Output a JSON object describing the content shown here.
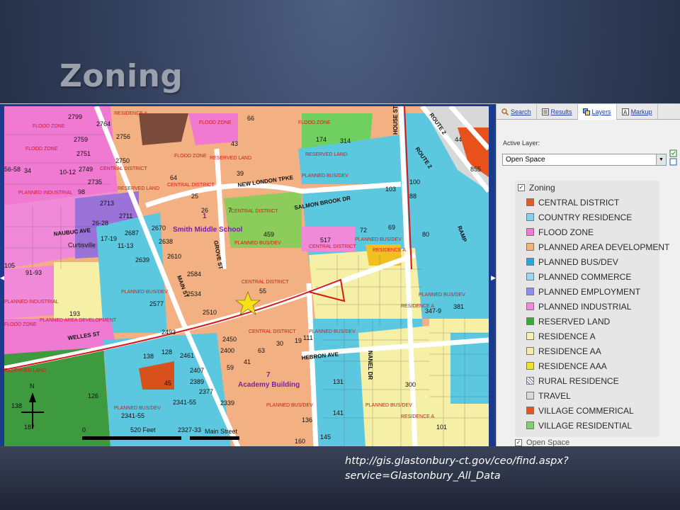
{
  "slide": {
    "title": "Zoning",
    "source_url": "http://gis.glastonbury-ct.gov/ceo/find.aspx?service=Glastonbury_All_Data"
  },
  "tabs": [
    {
      "label": "Search",
      "icon": "search-icon"
    },
    {
      "label": "Results",
      "icon": "results-icon"
    },
    {
      "label": "Layers",
      "icon": "layers-icon"
    },
    {
      "label": "Markup",
      "icon": "markup-icon"
    }
  ],
  "active_layer": {
    "label": "Active Layer:",
    "value": "Open Space"
  },
  "legend": {
    "group": "Zoning",
    "group_checked": true,
    "items": [
      {
        "label": "CENTRAL DISTRICT",
        "color": "#e05a2b"
      },
      {
        "label": "COUNTRY RESIDENCE",
        "color": "#7fd6ec"
      },
      {
        "label": "FLOOD ZONE",
        "color": "#f07ad2"
      },
      {
        "label": "PLANNED AREA DEVELOPMENT",
        "color": "#f2b27a"
      },
      {
        "label": "PLANNED BUS/DEV",
        "color": "#2aa6d8"
      },
      {
        "label": "PLANNED COMMERCE",
        "color": "#9fd4f0"
      },
      {
        "label": "PLANNED EMPLOYMENT",
        "color": "#8a8ff0"
      },
      {
        "label": "PLANNED INDUSTRIAL",
        "color": "#f08ad8"
      },
      {
        "label": "RESERVED LAND",
        "color": "#3aa83a"
      },
      {
        "label": "RESIDENCE A",
        "color": "#f8f0b0"
      },
      {
        "label": "RESIDENCE AA",
        "color": "#f4eca2"
      },
      {
        "label": "RESIDENCE AAA",
        "color": "#f0e030"
      },
      {
        "label": "RURAL RESIDENCE",
        "color": "hatch"
      },
      {
        "label": "TRAVEL",
        "color": "#d8d8d8"
      },
      {
        "label": "VILLAGE COMMERICAL",
        "color": "#e8501c"
      },
      {
        "label": "VILLAGE RESIDENTIAL",
        "color": "#7fcf6f"
      }
    ],
    "next_group": "Open Space"
  },
  "map": {
    "streets": {
      "new_london": "NEW LONDON TPKE",
      "salmon_brook": "SALMON BROOK DR",
      "welles": "WELLES ST",
      "hebron": "HEBRON AVE",
      "house": "HOUSE ST",
      "route2a": "ROUTE 2",
      "route2b": "ROUTE 2",
      "ramp": "RAMP",
      "grove": "GROVE ST",
      "main": "MAIN ST",
      "naubuc": "NAUBUC AVE",
      "nanel": "NANEL DR"
    },
    "places": {
      "smith_school": "Smith Middle School",
      "academy": "Academy Building",
      "curtisville": "Curtisville",
      "school_num1": "1",
      "academy_num": "7"
    },
    "zone_labels": {
      "flood": "FLOOD ZONE",
      "reserved": "RESERVED LAND",
      "central": "CENTRAL DISTRICT",
      "pbd": "PLANNED BUS/DEV",
      "pind": "PLANNED INDUSTRIAL",
      "pad": "PLANNED AREA DEVELOPMENT",
      "resa": "RESIDENCE A"
    },
    "parcels": {
      "p2799": "2799",
      "p2764": "2764",
      "p2759": "2759",
      "p2751": "2751",
      "p2756": "2756",
      "p2750": "2750",
      "p2749": "2749",
      "p2735": "2735",
      "p2713": "2713",
      "p2711": "2711",
      "p2687": "2687",
      "p2670": "2670",
      "p2638": "2638",
      "p2610": "2610",
      "p2639": "2639",
      "p2584": "2584",
      "p2534": "2534",
      "p2577": "2577",
      "p2510": "2510",
      "p2493": "2493",
      "p2461": "2461",
      "p2450": "2450",
      "p2400": "2400",
      "p2407": "2407",
      "p2389": "2389",
      "p2377": "2377",
      "p2341": "2341-55",
      "p2327": "2327-33",
      "p2341b": "2341-55",
      "p66": "66",
      "p174": "174",
      "p314": "314",
      "p43": "43",
      "p64": "64",
      "p39": "39",
      "p25": "25",
      "p26": "26",
      "p7": "7",
      "p459": "459",
      "p55": "55",
      "p103": "103",
      "p100": "100",
      "p88": "88",
      "p80": "80",
      "p517": "517",
      "p72": "72",
      "p69": "69",
      "p193": "193",
      "p138": "138",
      "p128": "128",
      "p45": "45",
      "p59": "59",
      "p41": "41",
      "p63": "63",
      "p30": "30",
      "p19": "19",
      "p111": "111",
      "p141": "141",
      "p131": "131",
      "p145": "145",
      "p160": "160",
      "p300": "300",
      "p381": "381",
      "p347": "347-9",
      "p44": "44",
      "p855": "855",
      "p2339": "2339",
      "p136": "136",
      "p187": "187",
      "p126": "126",
      "p5658": "56-58",
      "p34": "34",
      "p1012": "10-12",
      "p98": "98",
      "p2628": "26-28",
      "p1719": "17-19",
      "p1113": "11-13",
      "p9193": "91-93",
      "p105": "105",
      "p101": "101"
    },
    "scale": "520 Feet",
    "scale_zero": "0",
    "north": "N",
    "main_street_label": "Main Street"
  }
}
